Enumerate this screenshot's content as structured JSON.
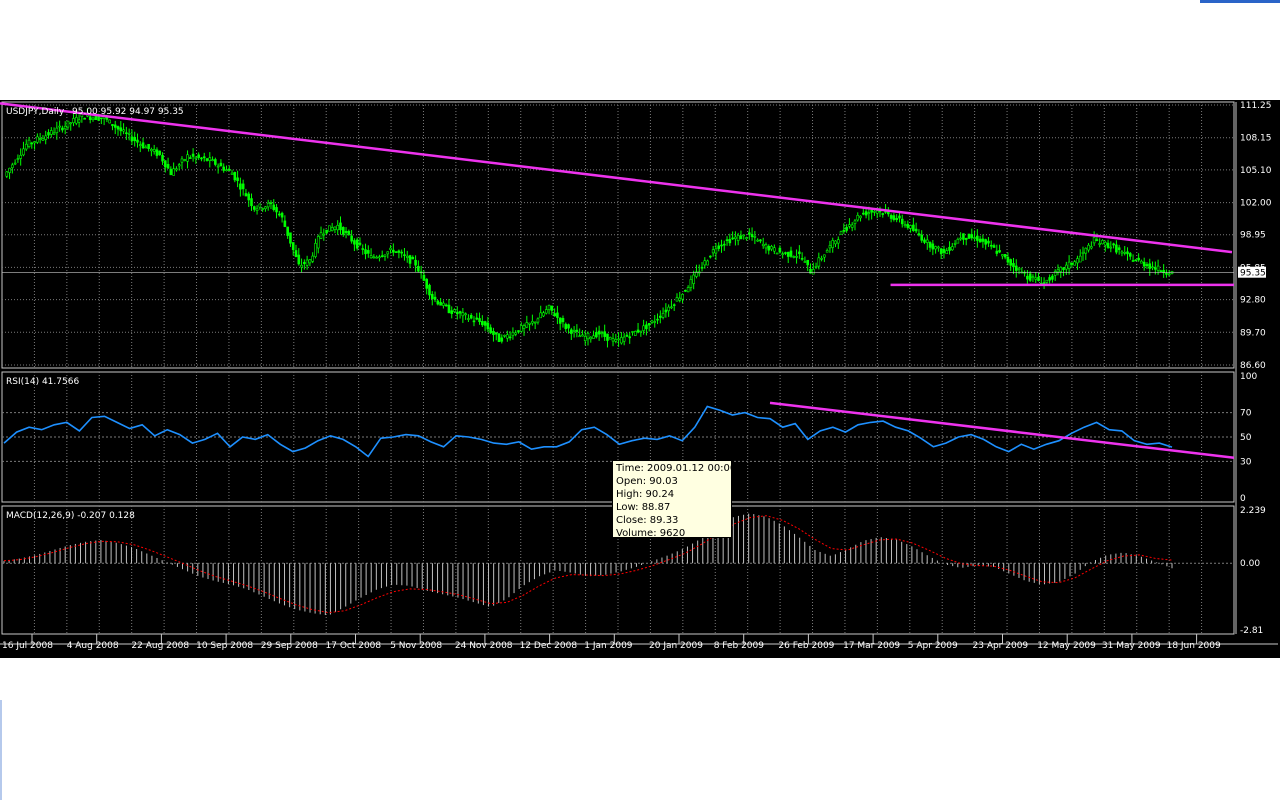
{
  "colors": {
    "background": "#000000",
    "grid": "#7a7a7a",
    "candle": "#00ff00",
    "rsi_line": "#1e90ff",
    "trendline": "#ee33ee",
    "macd_hist": "#c0c0c0",
    "macd_signal": "#ff0000",
    "tooltip_bg": "#ffffe1"
  },
  "price_panel": {
    "label": "USDJPY,Daily",
    "ohlc_text": "95.00 95.92 94.97 95.35",
    "current_price": "95.35",
    "current_price_shadow": "95.65",
    "y_ticks": [
      "111.25",
      "108.15",
      "105.10",
      "102.00",
      "98.95",
      "95.85",
      "92.80",
      "89.70",
      "86.60"
    ]
  },
  "rsi_panel": {
    "label": "RSI(14) 41.7566",
    "y_ticks": [
      "100",
      "70",
      "50",
      "30",
      "0"
    ]
  },
  "macd_panel": {
    "label": "MACD(12,26,9) -0.207 0.128",
    "y_ticks": [
      "2.239",
      "0.00",
      "-2.81"
    ]
  },
  "x_ticks": [
    "16 Jul 2008",
    "4 Aug 2008",
    "22 Aug 2008",
    "10 Sep 2008",
    "29 Sep 2008",
    "17 Oct 2008",
    "5 Nov 2008",
    "24 Nov 2008",
    "12 Dec 2008",
    "1 Jan 2009",
    "20 Jan 2009",
    "8 Feb 2009",
    "26 Feb 2009",
    "17 Mar 2009",
    "5 Apr 2009",
    "23 Apr 2009",
    "12 May 2009",
    "31 May 2009",
    "18 Jun 2009"
  ],
  "tooltip": {
    "time": "Time: 2009.01.12 00:00",
    "open": "Open: 90.03",
    "high": "High: 90.24",
    "low": "Low:  88.87",
    "close": "Close: 89.33",
    "volume": "Volume: 9620"
  },
  "chart_data": [
    {
      "type": "candlestick",
      "title": "USDJPY,Daily",
      "x": [
        "16 Jul 2008",
        "4 Aug 2008",
        "22 Aug 2008",
        "10 Sep 2008",
        "29 Sep 2008",
        "17 Oct 2008",
        "5 Nov 2008",
        "24 Nov 2008",
        "12 Dec 2008",
        "1 Jan 2009",
        "20 Jan 2009",
        "8 Feb 2009",
        "26 Feb 2009",
        "17 Mar 2009",
        "5 Apr 2009",
        "23 Apr 2009",
        "12 May 2009",
        "31 May 2009",
        "18 Jun 2009"
      ],
      "ylim": [
        86.6,
        111.25
      ],
      "close_path": [
        [
          0,
          104.5
        ],
        [
          8,
          107.5
        ],
        [
          16,
          108.5
        ],
        [
          22,
          109.3
        ],
        [
          28,
          110.2
        ],
        [
          36,
          110.0
        ],
        [
          42,
          108.8
        ],
        [
          50,
          107.4
        ],
        [
          56,
          106.5
        ],
        [
          60,
          104.8
        ],
        [
          66,
          106.4
        ],
        [
          74,
          106.0
        ],
        [
          82,
          104.8
        ],
        [
          90,
          101.5
        ],
        [
          96,
          101.8
        ],
        [
          100,
          100.5
        ],
        [
          106,
          96.0
        ],
        [
          110,
          96.5
        ],
        [
          114,
          99.2
        ],
        [
          120,
          99.8
        ],
        [
          126,
          98.2
        ],
        [
          132,
          96.8
        ],
        [
          140,
          97.5
        ],
        [
          148,
          96.2
        ],
        [
          154,
          93.0
        ],
        [
          160,
          91.8
        ],
        [
          166,
          91.2
        ],
        [
          172,
          90.6
        ],
        [
          178,
          89.0
        ],
        [
          184,
          89.8
        ],
        [
          190,
          90.6
        ],
        [
          196,
          92.0
        ],
        [
          202,
          90.2
        ],
        [
          208,
          89.2
        ],
        [
          214,
          89.6
        ],
        [
          220,
          88.8
        ],
        [
          226,
          89.6
        ],
        [
          232,
          90.4
        ],
        [
          238,
          91.8
        ],
        [
          244,
          93.4
        ],
        [
          250,
          95.6
        ],
        [
          256,
          97.8
        ],
        [
          262,
          98.6
        ],
        [
          268,
          98.9
        ],
        [
          274,
          97.8
        ],
        [
          280,
          97.2
        ],
        [
          286,
          97.0
        ],
        [
          290,
          95.5
        ],
        [
          296,
          97.5
        ],
        [
          302,
          99.4
        ],
        [
          308,
          100.9
        ],
        [
          314,
          101.3
        ],
        [
          320,
          100.6
        ],
        [
          326,
          99.6
        ],
        [
          332,
          98.2
        ],
        [
          338,
          97.2
        ],
        [
          344,
          98.8
        ],
        [
          350,
          98.6
        ],
        [
          356,
          97.6
        ],
        [
          362,
          96.2
        ],
        [
          368,
          95.0
        ],
        [
          374,
          94.4
        ],
        [
          380,
          95.6
        ],
        [
          386,
          96.6
        ],
        [
          392,
          98.4
        ],
        [
          398,
          97.9
        ],
        [
          404,
          96.9
        ],
        [
          410,
          96.2
        ],
        [
          416,
          95.6
        ],
        [
          420,
          95.35
        ]
      ],
      "trendlines": [
        {
          "from": [
            "16 Jul 2008",
            111.4
          ],
          "to": [
            "18 Jun 2009",
            97.3
          ]
        },
        {
          "from": [
            "17 Mar 2009",
            94.2
          ],
          "to": [
            "18 Jun 2009",
            94.2
          ]
        }
      ]
    },
    {
      "type": "line",
      "title": "RSI(14) 41.7566",
      "ylim": [
        0,
        100
      ],
      "levels": [
        70,
        50,
        30
      ],
      "values": [
        45,
        54,
        58,
        56,
        60,
        62,
        55,
        66,
        67,
        62,
        57,
        60,
        51,
        56,
        52,
        45,
        48,
        53,
        42,
        50,
        48,
        52,
        44,
        38,
        41,
        47,
        51,
        48,
        42,
        34,
        49,
        50,
        52,
        51,
        46,
        42,
        51,
        50,
        48,
        45,
        44,
        46,
        40,
        42,
        42,
        46,
        56,
        58,
        52,
        44,
        47,
        49,
        48,
        51,
        47,
        58,
        75,
        72,
        68,
        70,
        66,
        65,
        58,
        61,
        48,
        55,
        58,
        54,
        60,
        62,
        63,
        58,
        55,
        49,
        42,
        45,
        50,
        52,
        48,
        42,
        38,
        44,
        40,
        44,
        47,
        53,
        58,
        62,
        56,
        55,
        47,
        44,
        45,
        41.76
      ],
      "trendline": {
        "from": [
          "26 Feb 2009",
          78
        ],
        "to": [
          "18 Jun 2009",
          33
        ]
      }
    },
    {
      "type": "bar",
      "title": "MACD(12,26,9) -0.207 0.128",
      "ylim": [
        -2.81,
        2.239
      ],
      "values": [
        0.1,
        0.2,
        0.35,
        0.55,
        0.75,
        0.9,
        0.98,
        0.85,
        0.65,
        0.35,
        0.05,
        -0.25,
        -0.55,
        -0.75,
        -0.9,
        -1.1,
        -1.4,
        -1.7,
        -1.95,
        -2.1,
        -2.2,
        -1.85,
        -1.45,
        -1.1,
        -0.9,
        -0.95,
        -1.15,
        -1.3,
        -1.45,
        -1.65,
        -1.85,
        -1.5,
        -0.95,
        -0.55,
        -0.3,
        -0.4,
        -0.55,
        -0.5,
        -0.35,
        -0.15,
        0.1,
        0.35,
        0.65,
        1.05,
        1.6,
        1.95,
        2.1,
        1.95,
        1.6,
        1.1,
        0.55,
        0.3,
        0.6,
        0.95,
        1.1,
        1.0,
        0.7,
        0.3,
        -0.05,
        -0.2,
        -0.1,
        -0.15,
        -0.45,
        -0.75,
        -0.9,
        -0.8,
        -0.45,
        0.05,
        0.35,
        0.45,
        0.3,
        0.05,
        -0.21
      ],
      "signal": [
        0.1,
        0.15,
        0.28,
        0.45,
        0.65,
        0.82,
        0.92,
        0.9,
        0.78,
        0.55,
        0.28,
        0.0,
        -0.3,
        -0.55,
        -0.75,
        -0.95,
        -1.2,
        -1.48,
        -1.75,
        -1.95,
        -2.08,
        -2.0,
        -1.75,
        -1.45,
        -1.2,
        -1.08,
        -1.1,
        -1.2,
        -1.32,
        -1.5,
        -1.7,
        -1.65,
        -1.35,
        -0.95,
        -0.62,
        -0.48,
        -0.5,
        -0.52,
        -0.45,
        -0.3,
        -0.1,
        0.15,
        0.42,
        0.8,
        1.25,
        1.65,
        1.92,
        2.0,
        1.8,
        1.45,
        1.0,
        0.62,
        0.55,
        0.78,
        0.98,
        1.02,
        0.85,
        0.55,
        0.22,
        -0.02,
        -0.1,
        -0.12,
        -0.3,
        -0.55,
        -0.78,
        -0.82,
        -0.62,
        -0.25,
        0.1,
        0.3,
        0.35,
        0.2,
        0.13
      ]
    }
  ]
}
